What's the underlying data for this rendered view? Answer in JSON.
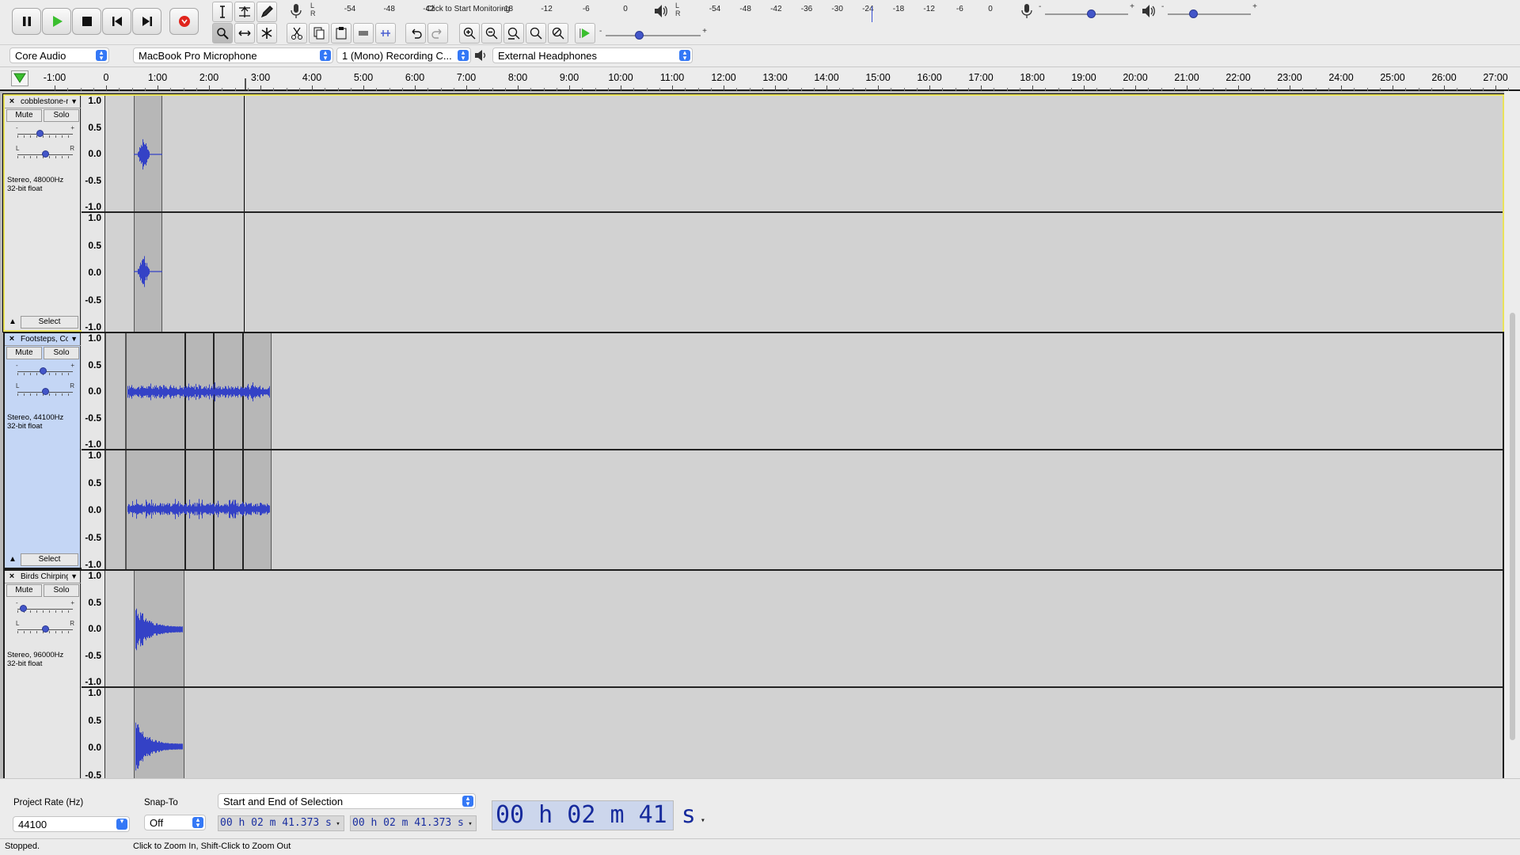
{
  "transport": {
    "pause": "pause-icon",
    "play": "play-icon",
    "stop": "stop-icon",
    "skip_start": "skip-to-start-icon",
    "skip_end": "skip-to-end-icon",
    "record": "record-icon"
  },
  "recording_meter": {
    "ticks": [
      "-54",
      "-48",
      "-42",
      "Click to Start Monitoring",
      "-18",
      "-12",
      "-6",
      "0"
    ],
    "lr": "L\nR"
  },
  "playback_meter": {
    "ticks": [
      "-54",
      "-48",
      "-42",
      "-36",
      "-30",
      "-24",
      "-18",
      "-12",
      "-6",
      "0"
    ],
    "lr": "L\nR"
  },
  "mixer": {
    "mic_minus": "-",
    "mic_plus": "+",
    "spk_minus": "-",
    "spk_plus": "+",
    "mic_level": 0.55,
    "spk_level": 0.3
  },
  "play_at_speed": {
    "minus": "-",
    "plus": "+",
    "level": 0.35
  },
  "devices": {
    "host": "Core Audio",
    "recording_device": "MacBook Pro Microphone",
    "channels": "1 (Mono) Recording C...",
    "playback_device": "External Headphones"
  },
  "ruler": {
    "labels": [
      "-1:00",
      "0",
      "1:00",
      "2:00",
      "3:00",
      "4:00",
      "5:00",
      "6:00",
      "7:00",
      "8:00",
      "9:00",
      "10:00",
      "11:00",
      "12:00",
      "13:00",
      "14:00",
      "15:00",
      "16:00",
      "17:00",
      "18:00",
      "19:00",
      "20:00",
      "21:00",
      "22:00",
      "23:00",
      "24:00",
      "25:00",
      "26:00",
      "27:00"
    ]
  },
  "vruler_labels": [
    "1.0",
    "0.5",
    "0.0",
    "-0.5",
    "-1.0"
  ],
  "tracks": [
    {
      "name": "cobblestone-r",
      "mute": "Mute",
      "solo": "Solo",
      "info1": "Stereo, 48000Hz",
      "info2": "32-bit float",
      "select": "Select",
      "gain": 0.4,
      "pan": 0.5
    },
    {
      "name": "Footsteps, Co",
      "mute": "Mute",
      "solo": "Solo",
      "info1": "Stereo, 44100Hz",
      "info2": "32-bit float",
      "select": "Select",
      "gain": 0.45,
      "pan": 0.5
    },
    {
      "name": "Birds Chirping",
      "mute": "Mute",
      "solo": "Solo",
      "info1": "Stereo, 96000Hz",
      "info2": "32-bit float",
      "select": "Select",
      "gain": 0.1,
      "pan": 0.5
    }
  ],
  "selection": {
    "project_rate_label": "Project Rate (Hz)",
    "project_rate": "44100",
    "snap_label": "Snap-To",
    "snap": "Off",
    "mode": "Start and End of Selection",
    "start": "00 h 02 m 41.373 s",
    "end": "00 h 02 m 41.373 s",
    "audio_position": "00 h 02 m 41 s"
  },
  "status": {
    "left": "Stopped.",
    "right": "Click to Zoom In, Shift-Click to Zoom Out"
  }
}
